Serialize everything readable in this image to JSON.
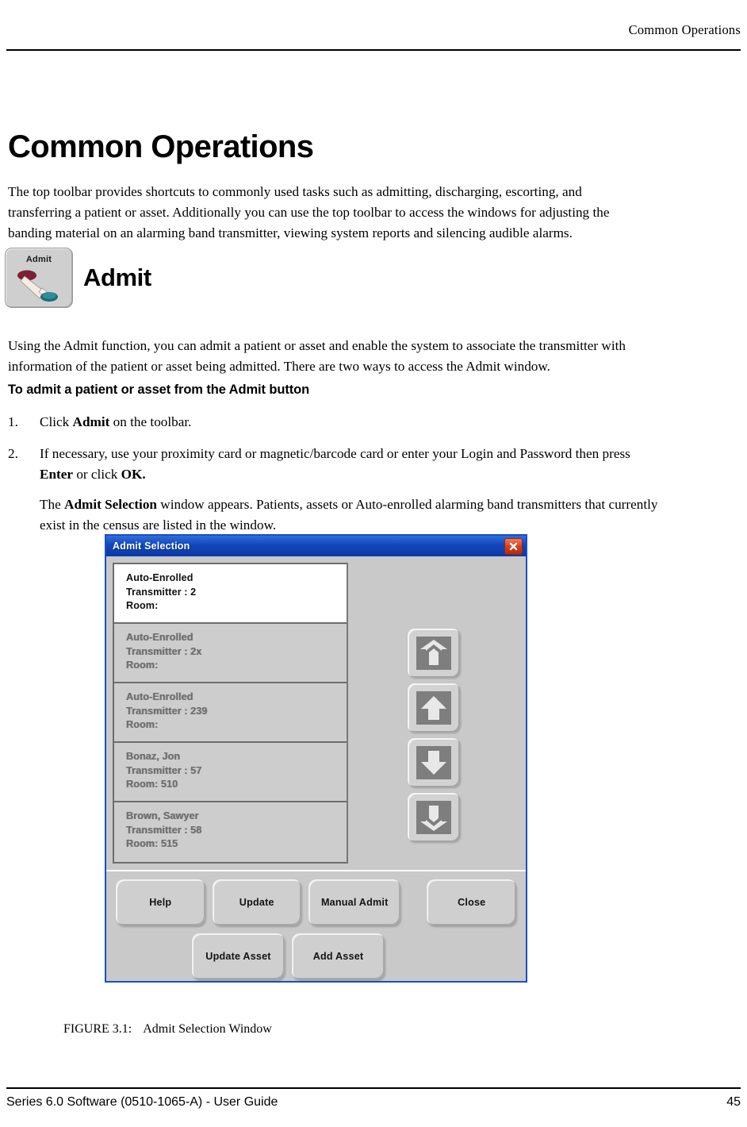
{
  "header": {
    "running_head": "Common Operations"
  },
  "chapter": {
    "title": "Common Operations",
    "intro": "The top toolbar provides shortcuts to commonly used tasks such as admitting, discharging, escorting, and transferring a patient or asset. Additionally you can use the top toolbar to access the windows for adjusting the banding material on an alarming band transmitter, viewing system reports and silencing audible alarms."
  },
  "admit_section": {
    "icon_label": "Admit",
    "heading": "Admit",
    "paragraph": "Using the Admit function, you can admit a patient or asset and enable the system to associate the transmitter with information of the patient or asset being admitted. There are two ways to access the Admit window.",
    "sub_heading": "To admit a patient or asset from the Admit button",
    "steps": [
      {
        "number": "1.",
        "text_before": "Click ",
        "bold": "Admit",
        "text_after": " on the toolbar.",
        "follow_up": null
      },
      {
        "number": "2.",
        "text_before": "If necessary, use your proximity card or magnetic/barcode card or enter your Login and Password then press ",
        "bold": "Enter",
        "text_mid": " or click ",
        "bold2": "OK.",
        "text_after": "",
        "follow_up_before": "The ",
        "follow_up_bold": "Admit Selection",
        "follow_up_after": " window appears. Patients, assets or Auto-enrolled alarming band transmitters that currently exist in the census are listed in the window."
      }
    ]
  },
  "dialog": {
    "title": "Admit Selection",
    "close_icon": "close-x-icon",
    "list_items": [
      {
        "line1": "Auto-Enrolled",
        "line2": "Transmitter : 2",
        "line3": "Room:",
        "selected": true
      },
      {
        "line1": "Auto-Enrolled",
        "line2": "Transmitter : 2x",
        "line3": "Room:",
        "selected": false
      },
      {
        "line1": "Auto-Enrolled",
        "line2": "Transmitter : 239",
        "line3": "Room:",
        "selected": false
      },
      {
        "line1": "Bonaz, Jon",
        "line2": "Transmitter : 57",
        "line3": "Room: 510",
        "selected": false
      },
      {
        "line1": "Brown, Sawyer",
        "line2": "Transmitter : 58",
        "line3": "Room: 515",
        "selected": false
      }
    ],
    "scroll_buttons": [
      {
        "name": "page-up-icon"
      },
      {
        "name": "arrow-up-icon"
      },
      {
        "name": "arrow-down-icon"
      },
      {
        "name": "page-down-icon"
      }
    ],
    "buttons": {
      "help": "Help",
      "update": "Update",
      "manual_admit": "Manual Admit",
      "close": "Close",
      "update_asset": "Update Asset",
      "add_asset": "Add Asset"
    },
    "colors": {
      "titlebar_blue": "#1246bb",
      "close_red": "#d8401e",
      "face_gray": "#c9c9c9",
      "selected_white": "#ffffff"
    }
  },
  "figure": {
    "number": "FIGURE 3.1:",
    "caption": "Admit Selection Window"
  },
  "footer": {
    "left": "Series 6.0 Software (0510-1065-A) - User Guide",
    "page_number": "45"
  }
}
